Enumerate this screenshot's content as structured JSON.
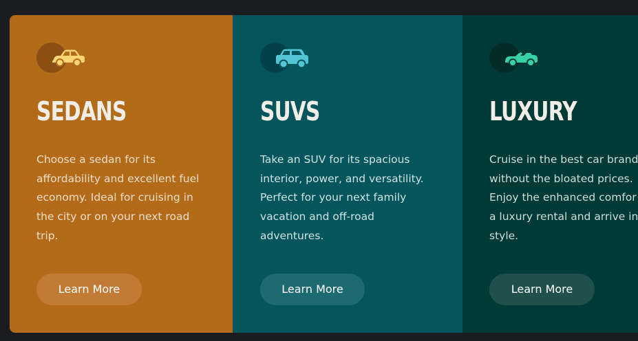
{
  "colors": {
    "page_background": "#1b1c20",
    "sedans_background": "#b36a19",
    "suvs_background": "#04565c",
    "luxury_background": "#003a36",
    "sedans_icon": "#fcd575",
    "suvs_icon": "#52c6d4",
    "luxury_icon": "#37d1a7",
    "title_text": "#f1eee8"
  },
  "cards": [
    {
      "icon": "sedan-car-icon",
      "title": "SEDANS",
      "text_lines": [
        "Choose a sedan for its",
        "affordability and excellent fuel",
        "economy. Ideal for cruising in",
        "the city or on your next road",
        "trip."
      ],
      "button_label": "Learn More"
    },
    {
      "icon": "suv-car-icon",
      "title": "SUVS",
      "text_lines": [
        "Take an SUV for its spacious",
        "interior, power, and versatility.",
        "Perfect for your next family",
        "vacation and off-road",
        "adventures."
      ],
      "button_label": "Learn More"
    },
    {
      "icon": "luxury-car-icon",
      "title": "LUXURY",
      "text_lines": [
        "Cruise in the best car brand",
        "without the bloated prices.",
        "Enjoy the enhanced comfor",
        "a luxury rental and arrive in",
        "style."
      ],
      "button_label": "Learn More"
    }
  ]
}
